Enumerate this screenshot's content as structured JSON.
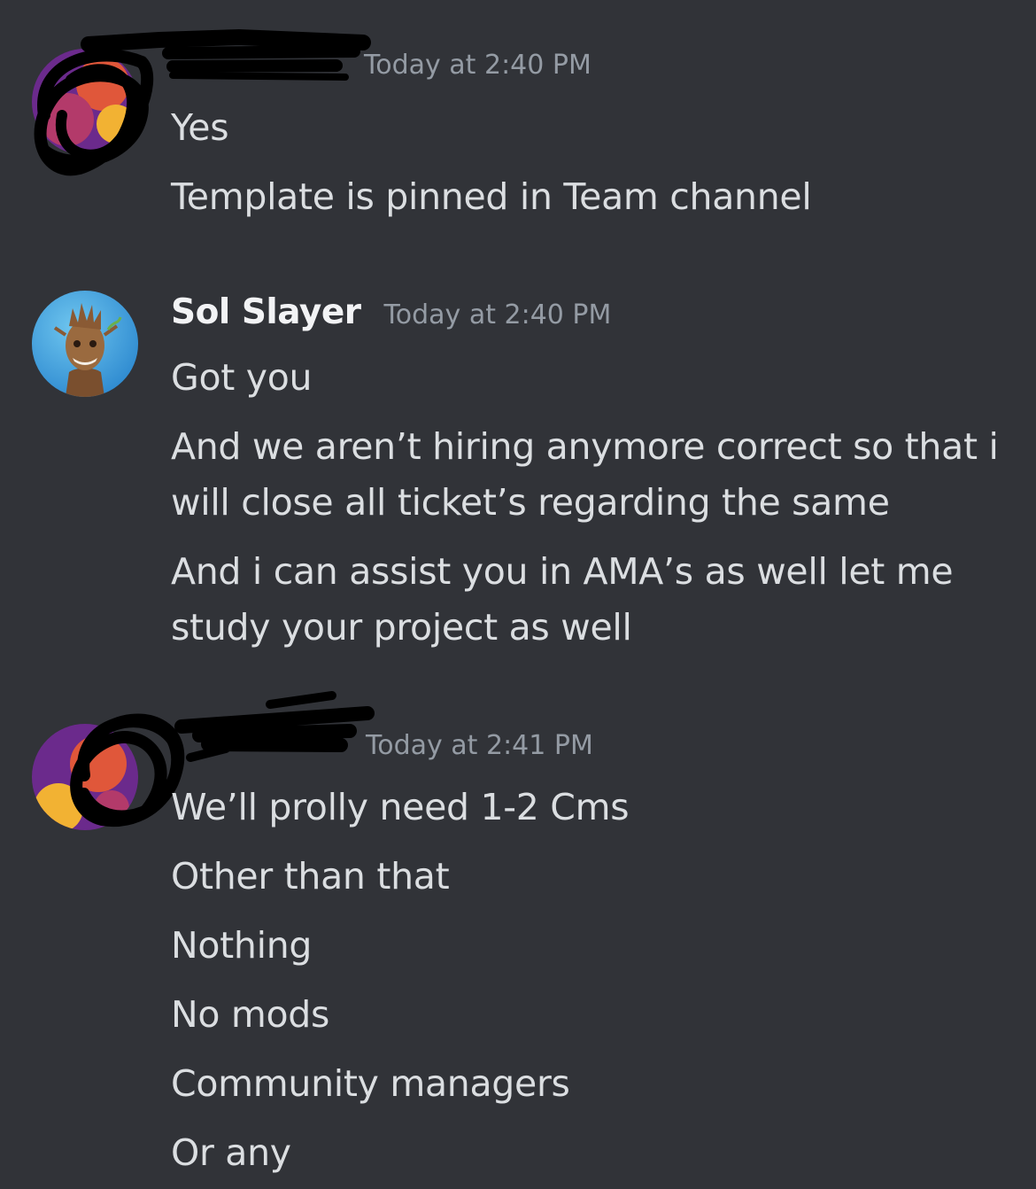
{
  "messages": [
    {
      "author": "",
      "timestamp": "Today at 2:40 PM",
      "avatar_icon": "redacted-avatar",
      "lines": [
        "Yes",
        "Template is pinned in Team channel"
      ]
    },
    {
      "author": "Sol Slayer",
      "timestamp": "Today at 2:40 PM",
      "avatar_icon": "groot-avatar",
      "lines": [
        "Got you",
        "And we aren’t hiring anymore correct so that i will close all ticket’s regarding the same",
        "And i can assist you in AMA’s as well let me study your project as well"
      ]
    },
    {
      "author": "",
      "timestamp": "Today at 2:41 PM",
      "avatar_icon": "redacted-avatar",
      "lines": [
        "We’ll prolly need 1-2 Cms",
        "Other than that",
        "Nothing",
        "No mods",
        "Community managers",
        "Or any"
      ]
    }
  ],
  "colors": {
    "background": "#313338",
    "text": "#dbdee1",
    "username": "#f2f3f5",
    "timestamp": "#949ba4"
  }
}
